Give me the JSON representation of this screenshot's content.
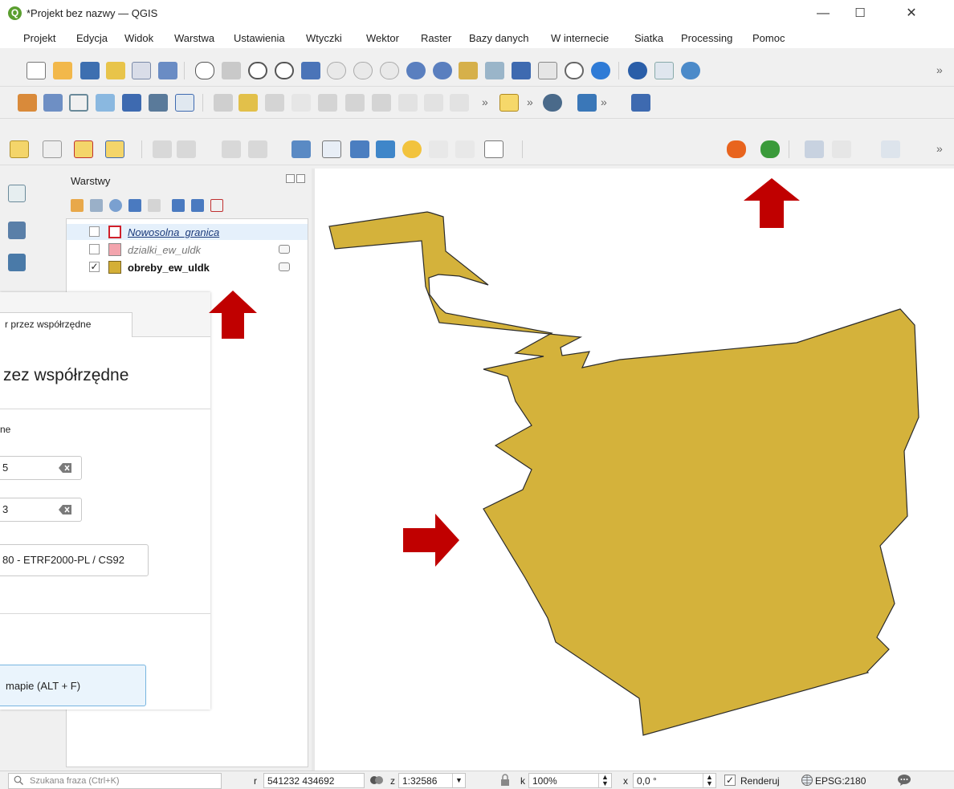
{
  "window": {
    "title": "*Projekt bez nazwy — QGIS",
    "logo_letter": "Q",
    "controls": [
      "—",
      "☐",
      "✕"
    ]
  },
  "menu": [
    "Projekt",
    "Edycja",
    "Widok",
    "Warstwa",
    "Ustawienia",
    "Wtyczki",
    "Wektor",
    "Raster",
    "Bazy danych",
    "W internecie",
    "Siatka",
    "Processing",
    "Pomoc"
  ],
  "toolbars": {
    "overflow": "»"
  },
  "layers_panel": {
    "title": "Warstwy",
    "layers": [
      {
        "name": "Nowosolna_granica",
        "checked": false,
        "swatch": "#ffffff",
        "stroke": "#d0202a",
        "style": "italic-underline"
      },
      {
        "name": "dzialki_ew_uldk",
        "checked": false,
        "swatch": "#f3a4ad",
        "stroke": "#888888",
        "style": "italic"
      },
      {
        "name": "obreby_ew_uldk",
        "checked": true,
        "swatch": "#d4af37",
        "stroke": "#7a6520",
        "style": "bold"
      }
    ],
    "check_mark": "✓"
  },
  "dialog": {
    "tab_label": "r przez współrzędne",
    "heading": "zez współrzędne",
    "section_label": "ne",
    "x_value": "5",
    "y_value": "3",
    "crs_value": "80 - ETRF2000-PL / CS92",
    "button_label": "mapie (ALT + F)"
  },
  "map": {
    "polygon_fill": "#d4b23b",
    "polygon_stroke": "#2b2b2b"
  },
  "arrows_color": "#c00000",
  "statusbar": {
    "search_placeholder": "Szukana fraza (Ctrl+K)",
    "coord_label": "r",
    "coordinates": "541232 434692",
    "scale_label": "z",
    "scale": "1:32586",
    "magnifier_label": "k",
    "magnifier": "100%",
    "rotation_label": "x",
    "rotation": "0,0 °",
    "render_label": "Renderuj",
    "render_checked": true,
    "crs": "EPSG:2180"
  }
}
